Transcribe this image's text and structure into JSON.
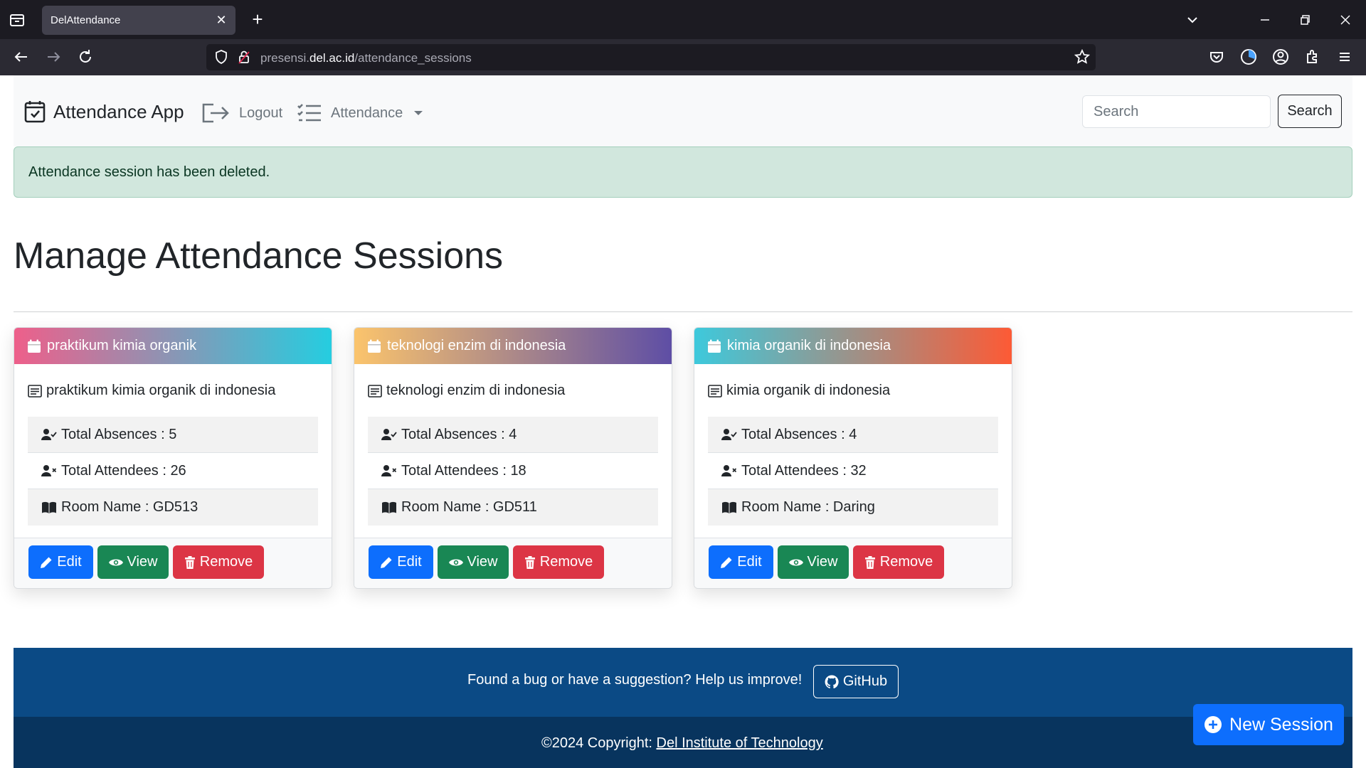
{
  "browser": {
    "tab_title": "DelAttendance",
    "url_prefix": "presensi.",
    "url_host": "del.ac.id",
    "url_path": "/attendance_sessions"
  },
  "nav": {
    "brand": "Attendance App",
    "logout": "Logout",
    "attendance": "Attendance",
    "search_placeholder": "Search",
    "search_button": "Search"
  },
  "alert": "Attendance session has been deleted.",
  "page_title": "Manage Attendance Sessions",
  "cards": [
    {
      "title": "praktikum kimia organik",
      "description": "praktikum kimia organik di indonesia",
      "absences": "Total Absences : 5",
      "attendees": "Total Attendees : 26",
      "room": "Room Name : GD513",
      "gradient_from": "#ee5f8a",
      "gradient_to": "#25cde0"
    },
    {
      "title": "teknologi enzim di indonesia",
      "description": "teknologi enzim di indonesia",
      "absences": "Total Absences : 4",
      "attendees": "Total Attendees : 18",
      "room": "Room Name : GD511",
      "gradient_from": "#fbc46c",
      "gradient_to": "#5e4ea5"
    },
    {
      "title": "kimia organik di indonesia",
      "description": "kimia organik di indonesia",
      "absences": "Total Absences : 4",
      "attendees": "Total Attendees : 32",
      "room": "Room Name : Daring",
      "gradient_from": "#3dc9dc",
      "gradient_to": "#fd5a35"
    }
  ],
  "buttons": {
    "edit": "Edit",
    "view": "View",
    "remove": "Remove"
  },
  "footer": {
    "text": "Found a bug or have a suggestion? Help us improve!",
    "github": "GitHub",
    "copyright_prefix": "©2024 Copyright: ",
    "copyright_link": "Del Institute of Technology"
  },
  "new_session": "New Session",
  "colors": {
    "primary": "#0d6efd",
    "success": "#198754",
    "danger": "#dc3545",
    "footer_top": "#0b4a85",
    "footer_bottom": "#08345e",
    "alert_bg": "#d1e7dd"
  }
}
